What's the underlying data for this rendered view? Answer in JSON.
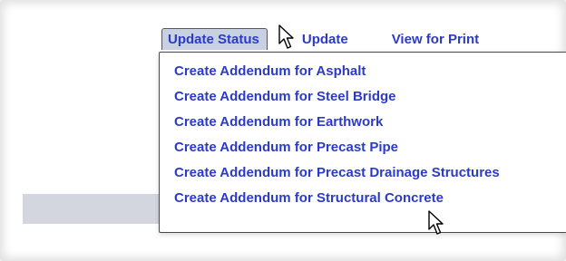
{
  "toolbar": {
    "update_status_label": "Update Status",
    "update_label": "Update",
    "view_for_print_label": "View for Print"
  },
  "dropdown": {
    "items": [
      {
        "label": "Create Addendum for Asphalt"
      },
      {
        "label": "Create Addendum for Steel Bridge"
      },
      {
        "label": "Create Addendum for Earthwork"
      },
      {
        "label": "Create Addendum for Precast Pipe"
      },
      {
        "label": "Create Addendum for Precast Drainage Structures"
      },
      {
        "label": "Create Addendum for Structural Concrete"
      }
    ]
  },
  "icons": {
    "cursor": "mouse-pointer-icon"
  },
  "colors": {
    "link": "#2b3bc8",
    "active_tab_bg": "#c8d1e2",
    "band": "#d3d6df"
  }
}
